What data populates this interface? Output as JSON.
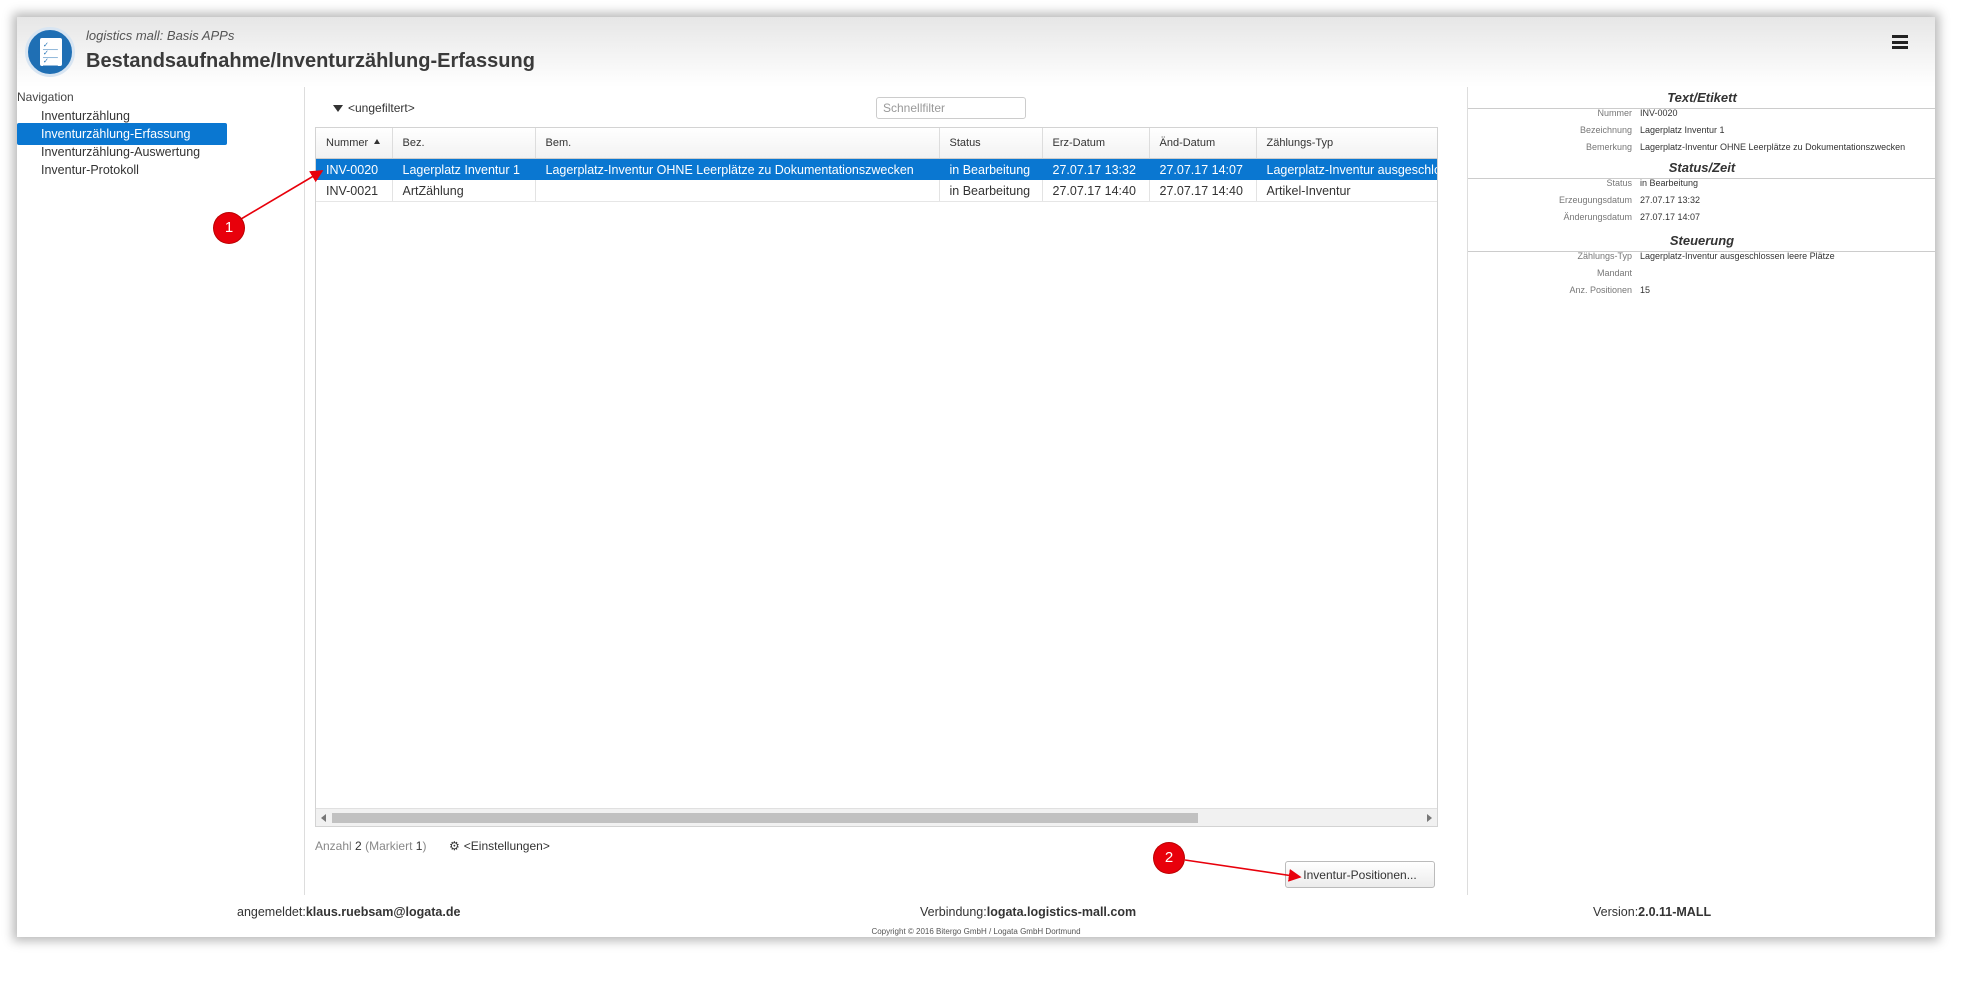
{
  "header": {
    "subtitle": "logistics mall: Basis APPs",
    "title": "Bestandsaufnahme/Inventurzählung-Erfassung"
  },
  "navigation": {
    "title": "Navigation",
    "items": [
      {
        "label": "Inventurzählung",
        "active": false
      },
      {
        "label": "Inventurzählung-Erfassung",
        "active": true
      },
      {
        "label": "Inventurzählung-Auswertung",
        "active": false
      },
      {
        "label": "Inventur-Protokoll",
        "active": false
      }
    ]
  },
  "toolbar": {
    "filter_status": "<ungefiltert>",
    "quickfilter_placeholder": "Schnellfilter"
  },
  "table": {
    "columns": [
      "Nummer",
      "Bez.",
      "Bem.",
      "Status",
      "Erz-Datum",
      "Änd-Datum",
      "Zählungs-Typ"
    ],
    "sort_column": "Nummer",
    "rows": [
      {
        "nummer": "INV-0020",
        "bez": "Lagerplatz Inventur 1",
        "bem": "Lagerplatz-Inventur OHNE Leerplätze zu Dokumentationszwecken",
        "status": "in Bearbeitung",
        "erz": "27.07.17 13:32",
        "aend": "27.07.17 14:07",
        "typ": "Lagerplatz-Inventur ausgeschlossen leere Plätze",
        "selected": true
      },
      {
        "nummer": "INV-0021",
        "bez": "ArtZählung",
        "bem": "",
        "status": "in Bearbeitung",
        "erz": "27.07.17 14:40",
        "aend": "27.07.17 14:40",
        "typ": "Artikel-Inventur",
        "selected": false
      }
    ]
  },
  "summary": {
    "count_label": "Anzahl",
    "count": "2",
    "marked_label": "Markiert",
    "marked": "1",
    "settings_label": "<Einstellungen>"
  },
  "buttons": {
    "positions": "Inventur-Positionen..."
  },
  "detail": {
    "sections": [
      {
        "title": "Text/Etikett",
        "fields": [
          {
            "key": "Nummer",
            "value": "INV-0020"
          },
          {
            "key": "Bezeichnung",
            "value": "Lagerplatz Inventur 1"
          },
          {
            "key": "Bemerkung",
            "value": "Lagerplatz-Inventur OHNE Leerplätze zu Dokumentationszwecken"
          }
        ]
      },
      {
        "title": "Status/Zeit",
        "fields": [
          {
            "key": "Status",
            "value": "in Bearbeitung"
          },
          {
            "key": "Erzeugungsdatum",
            "value": "27.07.17 13:32"
          },
          {
            "key": "Änderungsdatum",
            "value": "27.07.17 14:07"
          }
        ]
      },
      {
        "title": "Steuerung",
        "fields": [
          {
            "key": "Zählungs-Typ",
            "value": "Lagerplatz-Inventur ausgeschlossen leere Plätze"
          },
          {
            "key": "Mandant",
            "value": ""
          },
          {
            "key": "Anz. Positionen",
            "value": "15"
          }
        ]
      }
    ]
  },
  "footer": {
    "user_label": "angemeldet:",
    "user": "klaus.ruebsam@logata.de",
    "connection_label": "Verbindung:",
    "connection": "logata.logistics-mall.com",
    "version_label": "Version:",
    "version": "2.0.11-MALL",
    "copyright": "Copyright © 2016 Bitergo GmbH / Logata GmbH Dortmund"
  },
  "annotations": {
    "marker_1": "1",
    "marker_2": "2",
    "color": "#e8000b"
  },
  "colors": {
    "accent": "#0a77d1"
  }
}
